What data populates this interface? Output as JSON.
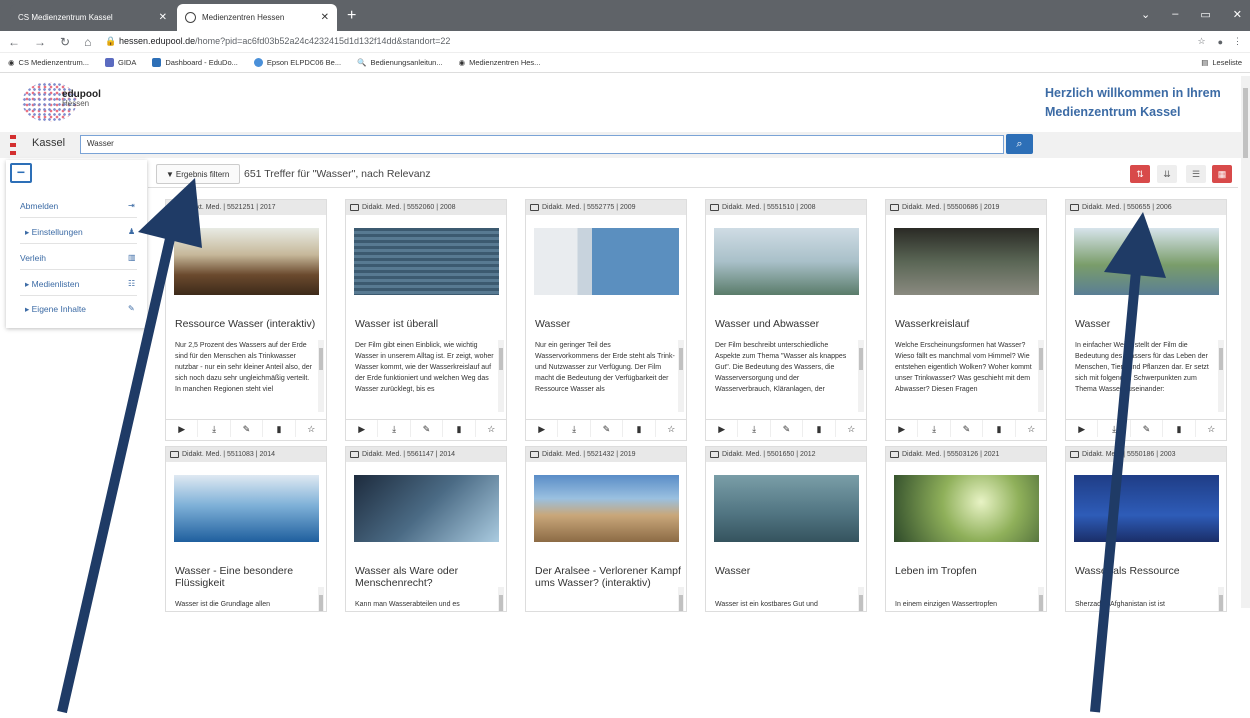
{
  "browser": {
    "tabs": [
      {
        "label": "CS Medienzentrum Kassel"
      },
      {
        "label": "Medienzentren Hessen"
      }
    ],
    "url_prefix": "hessen.edupool.de",
    "url_rest": "/home?pid=ac6fd03b52a24c4232415d1d132f14dd&standort=22",
    "bookmarks": [
      "CS Medienzentrum...",
      "GIDA",
      "Dashboard - EduDo...",
      "Epson ELPDC06 Be...",
      "Bedienungsanleitun...",
      "Medienzentren Hes..."
    ],
    "reading_list": "Leseliste"
  },
  "logo": {
    "name": "edupool",
    "sub": "Hessen"
  },
  "welcome": {
    "line1": "Herzlich willkommen in Ihrem",
    "line2": "Medienzentrum Kassel"
  },
  "search": {
    "location": "Kassel",
    "query": "Wasser"
  },
  "sidebar": {
    "items": [
      {
        "label": "Abmelden"
      },
      {
        "label": "Einstellungen"
      },
      {
        "label": "Verleih"
      },
      {
        "label": "Medienlisten"
      },
      {
        "label": "Eigene Inhalte"
      }
    ]
  },
  "results": {
    "filter_label": "Ergebnis filtern",
    "count_text": "651 Treffer für \"Wasser\", nach Relevanz"
  },
  "cards": [
    {
      "meta": "Didakt. Med. | 5521251 | 2017",
      "title": "Ressource Wasser (interaktiv)",
      "desc": "Nur 2,5 Prozent des Wassers auf der Erde sind für den Menschen als Trinkwasser nutzbar - nur ein sehr kleiner Anteil also, der sich noch dazu sehr ungleichmäßig verteilt. In manchen Regionen steht viel"
    },
    {
      "meta": "Didakt. Med. | 5552060 | 2008",
      "title": "Wasser ist überall",
      "desc": "Der Film gibt einen Einblick, wie wichtig Wasser in unserem Alltag ist. Er zeigt, woher Wasser kommt, wie der Wasserkreislauf auf der Erde funktioniert und welchen Weg das Wasser zurücklegt, bis es"
    },
    {
      "meta": "Didakt. Med. | 5552775 | 2009",
      "title": "Wasser",
      "desc": "Nur ein geringer Teil des Wasservorkommens der Erde steht als Trink- und Nutzwasser zur Verfügung. Der Film macht die Bedeutung der Verfügbarkeit der Ressource Wasser als"
    },
    {
      "meta": "Didakt. Med. | 5551510 | 2008",
      "title": "Wasser und Abwasser",
      "desc": "Der Film beschreibt unterschiedliche Aspekte zum Thema \"Wasser als knappes Gut\". Die Bedeutung des Wassers, die Wasserversorgung und der Wasserverbrauch, Kläranlagen, der"
    },
    {
      "meta": "Didakt. Med. | 55500686 | 2019",
      "title": "Wasserkreislauf",
      "desc": "Welche Erscheinungsformen hat Wasser? Wieso fällt es manchmal vom Himmel? Wie entstehen eigentlich Wolken? Woher kommt unser Trinkwasser? Was geschieht mit dem Abwasser? Diesen Fragen"
    },
    {
      "meta": "Didakt. Med. | 550655 | 2006",
      "title": "Wasser",
      "desc": "In einfacher Weise stellt der Film die Bedeutung des Wassers für das Leben der Menschen, Tiere und Pflanzen dar. Er setzt sich mit folgenden Schwerpunkten zum Thema Wasser auseinander:"
    },
    {
      "meta": "Didakt. Med. | 5511083 | 2014",
      "title": "Wasser - Eine besondere Flüssigkeit",
      "desc": "Wasser ist die Grundlage allen"
    },
    {
      "meta": "Didakt. Med. | 5561147 | 2014",
      "title": "Wasser als Ware oder Menschenrecht?",
      "desc": "Kann man Wasserabteilen und es"
    },
    {
      "meta": "Didakt. Med. | 5521432 | 2019",
      "title": "Der Aralsee - Verlorener Kampf ums Wasser? (interaktiv)",
      "desc": ""
    },
    {
      "meta": "Didakt. Med. | 5501650 | 2012",
      "title": "Wasser",
      "desc": "Wasser ist ein kostbares Gut und"
    },
    {
      "meta": "Didakt. Med. | 55503126 | 2021",
      "title": "Leben im Tropfen",
      "desc": "In einem einzigen Wassertropfen"
    },
    {
      "meta": "Didakt. Med. | 5550186 | 2003",
      "title": "Wasser als Ressource",
      "desc": "Sherzad in Afghanistan ist ist"
    }
  ],
  "colors": {
    "accent": "#2d6fb7",
    "red": "#d84a4a",
    "title_blue": "#3c6ba5"
  }
}
